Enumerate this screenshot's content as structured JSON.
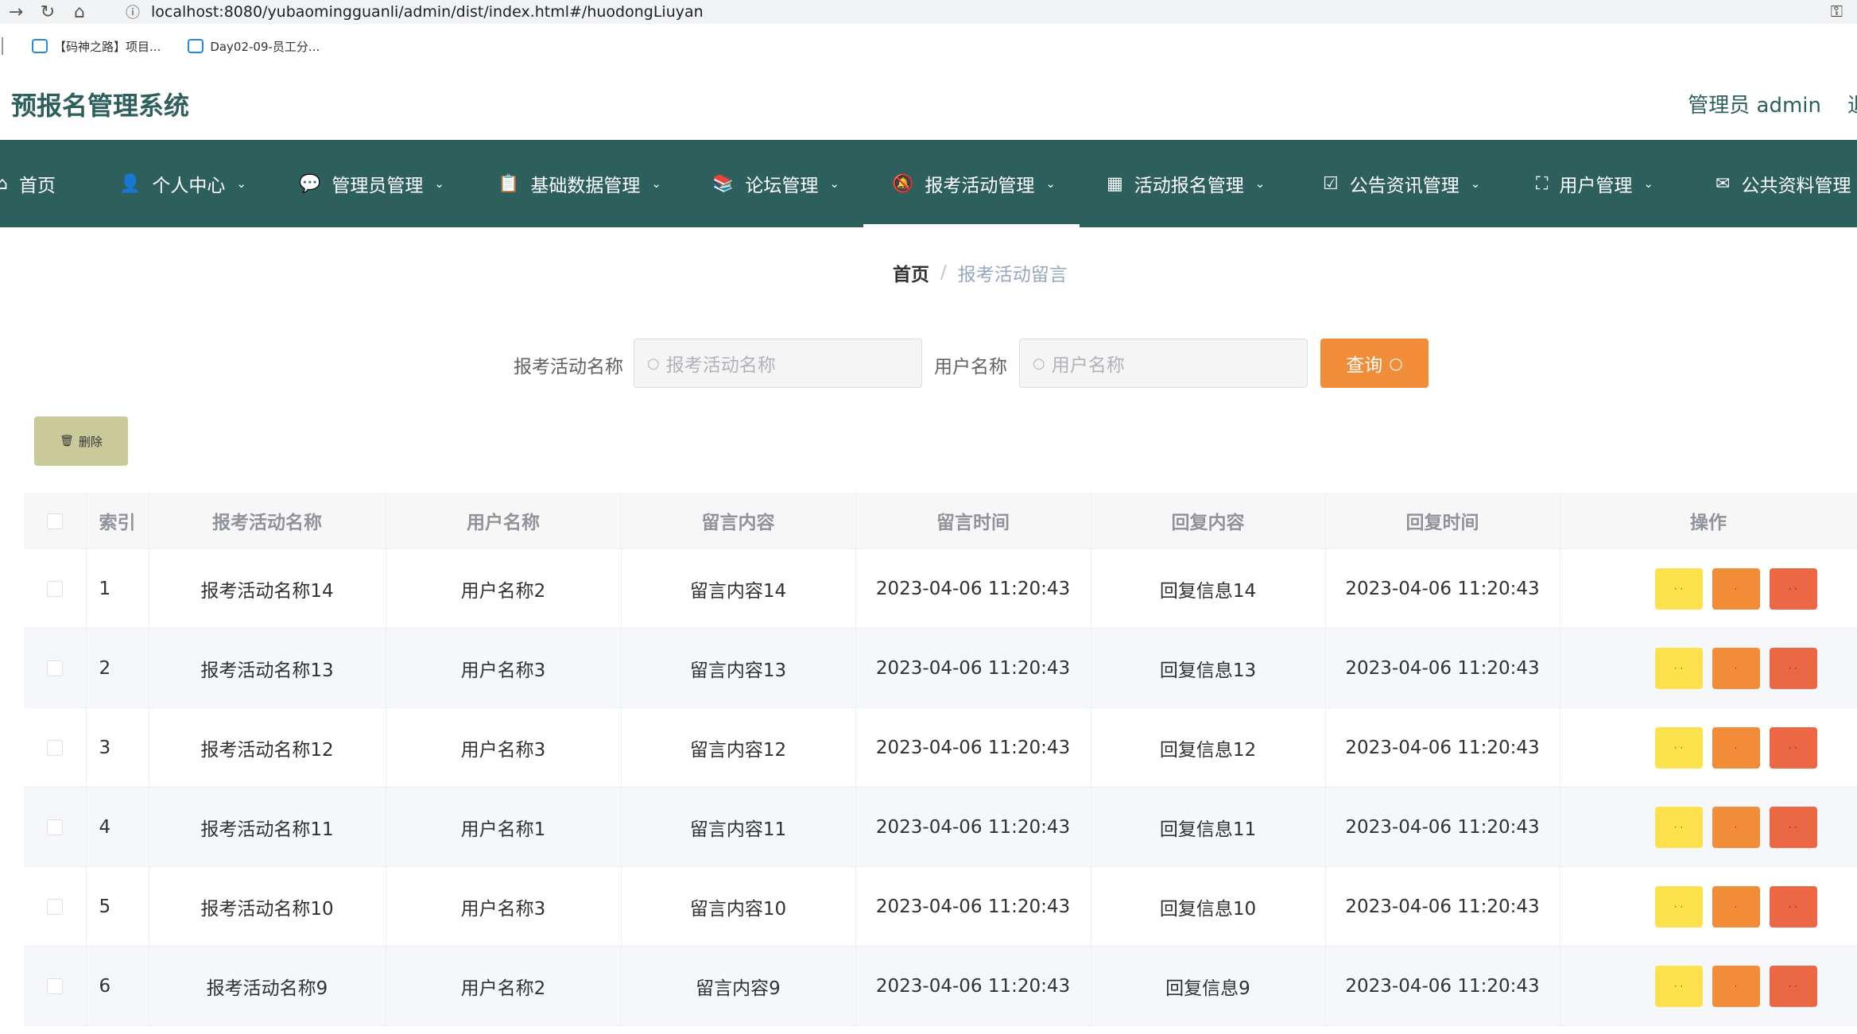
{
  "browser": {
    "url": "localhost:8080/yubaomingguanli/admin/dist/index.html#/huodongLiuyan",
    "bookmarks": [
      "【码神之路】项目...",
      "Day02-09-员工分..."
    ]
  },
  "header": {
    "app_title": "预报名管理系统",
    "user_label": "管理员 admin",
    "logout_partial": "退"
  },
  "nav": {
    "items": [
      {
        "label": "首页",
        "icon": "home-icon",
        "glyph": "⌂",
        "dropdown": false
      },
      {
        "label": "个人中心",
        "icon": "user-icon",
        "glyph": "👤",
        "dropdown": true
      },
      {
        "label": "管理员管理",
        "icon": "chat-icon",
        "glyph": "💬",
        "dropdown": true
      },
      {
        "label": "基础数据管理",
        "icon": "clipboard-icon",
        "glyph": "📋",
        "dropdown": true
      },
      {
        "label": "论坛管理",
        "icon": "book-icon",
        "glyph": "📚",
        "dropdown": true
      },
      {
        "label": "报考活动管理",
        "icon": "bell-off-icon",
        "glyph": "🔕",
        "dropdown": true,
        "active": true
      },
      {
        "label": "活动报名管理",
        "icon": "grid-icon",
        "glyph": "▦",
        "dropdown": true
      },
      {
        "label": "公告资讯管理",
        "icon": "checklist-icon",
        "glyph": "☑",
        "dropdown": true
      },
      {
        "label": "用户管理",
        "icon": "fullscreen-icon",
        "glyph": "⛶",
        "dropdown": true
      },
      {
        "label": "公共资料管理",
        "icon": "mail-icon",
        "glyph": "✉",
        "dropdown": false
      }
    ]
  },
  "breadcrumb": {
    "home": "首页",
    "separator": "/",
    "current": "报考活动留言"
  },
  "search": {
    "activity_label": "报考活动名称",
    "activity_placeholder": "报考活动名称",
    "user_label": "用户名称",
    "user_placeholder": "用户名称",
    "query_button": "查询"
  },
  "toolbar": {
    "delete_button": "删除"
  },
  "table": {
    "columns": [
      "索引",
      "报考活动名称",
      "用户名称",
      "留言内容",
      "留言时间",
      "回复内容",
      "回复时间",
      "操作"
    ],
    "rows": [
      [
        "1",
        "报考活动名称14",
        "用户名称2",
        "留言内容14",
        "2023-04-06 11:20:43",
        "回复信息14",
        "2023-04-06 11:20:43"
      ],
      [
        "2",
        "报考活动名称13",
        "用户名称3",
        "留言内容13",
        "2023-04-06 11:20:43",
        "回复信息13",
        "2023-04-06 11:20:43"
      ],
      [
        "3",
        "报考活动名称12",
        "用户名称3",
        "留言内容12",
        "2023-04-06 11:20:43",
        "回复信息12",
        "2023-04-06 11:20:43"
      ],
      [
        "4",
        "报考活动名称11",
        "用户名称1",
        "留言内容11",
        "2023-04-06 11:20:43",
        "回复信息11",
        "2023-04-06 11:20:43"
      ],
      [
        "5",
        "报考活动名称10",
        "用户名称3",
        "留言内容10",
        "2023-04-06 11:20:43",
        "回复信息10",
        "2023-04-06 11:20:43"
      ],
      [
        "6",
        "报考活动名称9",
        "用户名称2",
        "留言内容9",
        "2023-04-06 11:20:43",
        "回复信息9",
        "2023-04-06 11:20:43"
      ]
    ],
    "action_buttons": [
      {
        "color": "#fde14d",
        "name": "detail-button",
        "label": "· ·"
      },
      {
        "color": "#f18c39",
        "name": "reply-button",
        "label": "·"
      },
      {
        "color": "#ec6743",
        "name": "row-delete-button",
        "label": "· ·"
      }
    ]
  },
  "colors": {
    "primary": "#2d5f5d",
    "query": "#f18c39",
    "delete": "#c9ca9a"
  }
}
